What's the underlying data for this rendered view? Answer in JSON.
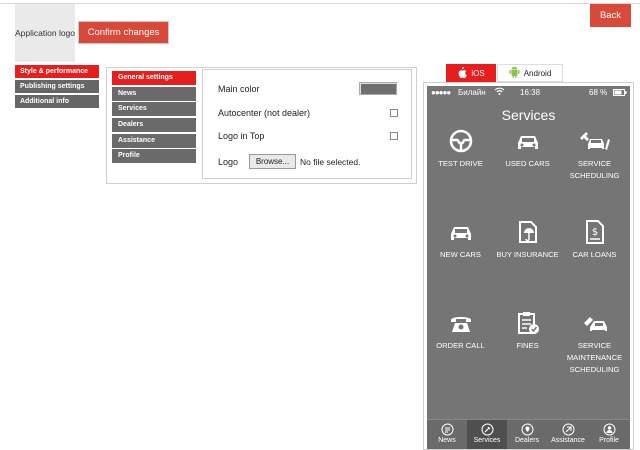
{
  "header": {
    "logo_label": "Application logo",
    "confirm_label": "Confirm changes",
    "back_label": "Back"
  },
  "side_nav": [
    {
      "label": "Style & performance",
      "active": true
    },
    {
      "label": "Publishing settings",
      "active": false
    },
    {
      "label": "Additional info",
      "active": false
    }
  ],
  "sub_nav": [
    {
      "label": "General settings",
      "active": true
    },
    {
      "label": "News",
      "active": false
    },
    {
      "label": "Services",
      "active": false
    },
    {
      "label": "Dealers",
      "active": false
    },
    {
      "label": "Assistance",
      "active": false
    },
    {
      "label": "Profile",
      "active": false
    }
  ],
  "form": {
    "main_color_label": "Main color",
    "main_color_value": "#6f6f6f",
    "autocenter_label": "Autocenter (not dealer)",
    "autocenter_checked": false,
    "logo_top_label": "Logo in Top",
    "logo_top_checked": false,
    "logo_label": "Logo",
    "browse_label": "Browse...",
    "no_file_label": "No file selected."
  },
  "preview": {
    "tabs": [
      {
        "label": "iOS",
        "icon": "apple-icon",
        "active": true
      },
      {
        "label": "Android",
        "icon": "android-icon",
        "active": false
      }
    ],
    "status": {
      "carrier": "Билайн",
      "time": "16:38",
      "battery": "68 %"
    },
    "title": "Services",
    "services": [
      {
        "label": "TEST DRIVE",
        "icon": "steering-wheel-icon"
      },
      {
        "label": "USED CARS",
        "icon": "car-icon"
      },
      {
        "label": "SERVICE SCHEDULING",
        "icon": "car-service-icon"
      },
      {
        "label": "NEW CARS",
        "icon": "car-icon"
      },
      {
        "label": "BUY INSURANCE",
        "icon": "insurance-icon"
      },
      {
        "label": "CAR LOANS",
        "icon": "loan-document-icon"
      },
      {
        "label": "ORDER CALL",
        "icon": "phone-icon"
      },
      {
        "label": "FINES",
        "icon": "fines-clipboard-icon"
      },
      {
        "label": "SERVICE MAINTENANCE SCHEDULING",
        "icon": "maintenance-icon"
      }
    ],
    "tabbar": [
      {
        "label": "News",
        "icon": "news-icon",
        "active": false
      },
      {
        "label": "Services",
        "icon": "services-icon",
        "active": true
      },
      {
        "label": "Dealers",
        "icon": "dealers-icon",
        "active": false
      },
      {
        "label": "Assistance",
        "icon": "assistance-icon",
        "active": false
      },
      {
        "label": "Profile",
        "icon": "profile-icon",
        "active": false
      }
    ]
  },
  "colors": {
    "accent_red": "#e61e1e",
    "button_red": "#d9493a",
    "phone_bg": "#757575",
    "nav_gray": "#666666"
  }
}
